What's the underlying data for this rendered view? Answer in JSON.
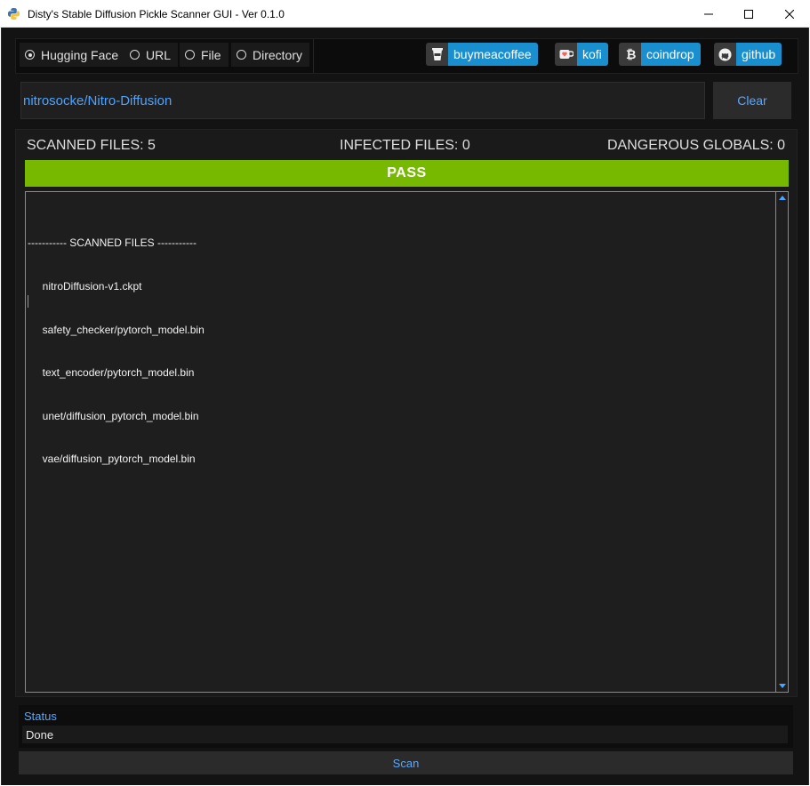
{
  "window": {
    "title": "Disty's Stable Diffusion Pickle Scanner GUI - Ver 0.1.0"
  },
  "source_options": [
    {
      "label": "Hugging Face",
      "selected": true
    },
    {
      "label": "URL",
      "selected": false
    },
    {
      "label": "File",
      "selected": false
    },
    {
      "label": "Directory",
      "selected": false
    }
  ],
  "links": [
    {
      "label": "buymeacoffee",
      "icon": "coffee-cup-icon"
    },
    {
      "label": "kofi",
      "icon": "kofi-cup-icon"
    },
    {
      "label": "coindrop",
      "icon": "bitcoin-icon"
    },
    {
      "label": "github",
      "icon": "github-icon"
    }
  ],
  "repo_input": {
    "value": "nitrosocke/Nitro-Diffusion"
  },
  "clear_label": "Clear",
  "stats": {
    "scanned_label": "SCANNED FILES:",
    "scanned_value": "5",
    "infected_label": "INFECTED FILES:",
    "infected_value": "0",
    "dangerous_label": "DANGEROUS GLOBALS:",
    "dangerous_value": "0"
  },
  "result": {
    "label": "PASS",
    "color": "#76b900"
  },
  "log": {
    "lines": [
      "----------- SCANNED FILES -----------",
      "     nitroDiffusion-v1.ckpt",
      "     safety_checker/pytorch_model.bin",
      "     text_encoder/pytorch_model.bin",
      "     unet/diffusion_pytorch_model.bin",
      "     vae/diffusion_pytorch_model.bin"
    ]
  },
  "status": {
    "title": "Status",
    "value": "Done"
  },
  "scan_label": "Scan",
  "colors": {
    "accent": "#1a8fcf",
    "text_link": "#5aa7ff",
    "background": "#131313"
  }
}
